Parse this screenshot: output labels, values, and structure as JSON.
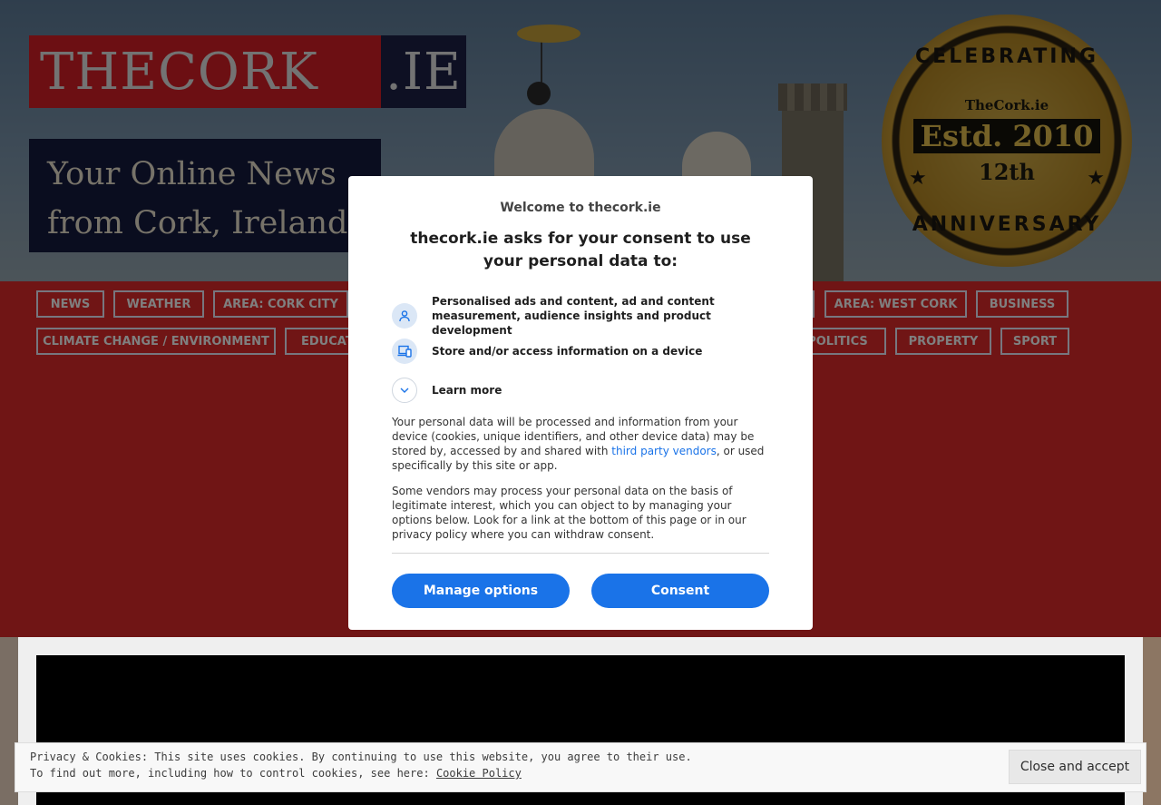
{
  "site": {
    "logo_main": "THECORK",
    "logo_ext": ".IE",
    "tagline_line1": "Your Online News",
    "tagline_line2": "from Cork, Ireland"
  },
  "badge": {
    "ring_top": "CELEBRATING",
    "site": "TheCork.ie",
    "established": "Estd. 2010",
    "year": "12th",
    "ring_bottom": "ANNIVERSARY"
  },
  "nav": {
    "items": [
      {
        "label": "NEWS"
      },
      {
        "label": "WEATHER"
      },
      {
        "label": "AREA: CORK CITY"
      },
      {
        "label": ""
      },
      {
        "label": "AREA: WEST CORK"
      },
      {
        "label": "BUSINESS"
      },
      {
        "label": "CLIMATE CHANGE / ENVIRONMENT"
      },
      {
        "label": "EDUCATI"
      },
      {
        "label": "POLITICS"
      },
      {
        "label": "PROPERTY"
      },
      {
        "label": "SPORT"
      }
    ]
  },
  "consent": {
    "welcome": "Welcome to thecork.ie",
    "heading": "thecork.ie asks for your consent to use your personal data to:",
    "purposes": [
      {
        "label": "Personalised ads and content, ad and content measurement, audience insights and product development",
        "icon": "person-icon"
      },
      {
        "label": "Store and/or access information on a device",
        "icon": "devices-icon"
      }
    ],
    "learn_more": "Learn more",
    "para1_before": "Your personal data will be processed and information from your device (cookies, unique identifiers, and other device data) may be stored by, accessed by and shared with ",
    "para1_link": "third party vendors",
    "para1_after": ", or used specifically by this site or app.",
    "para2": "Some vendors may process your personal data on the basis of legitimate interest, which you can object to by managing your options below. Look for a link at the bottom of this page or in our privacy policy where you can withdraw consent.",
    "manage_label": "Manage options",
    "consent_label": "Consent",
    "accent_color": "#1a73e8"
  },
  "cookie_bar": {
    "line1": "Privacy & Cookies: This site uses cookies. By continuing to use this website, you agree to their use.",
    "line2_prefix": "To find out more, including how to control cookies, see here: ",
    "link": "Cookie Policy",
    "button": "Close and accept"
  },
  "colors": {
    "nav_red": "#e02b2b",
    "logo_red": "#d91f26",
    "logo_navy": "#1d2147"
  }
}
